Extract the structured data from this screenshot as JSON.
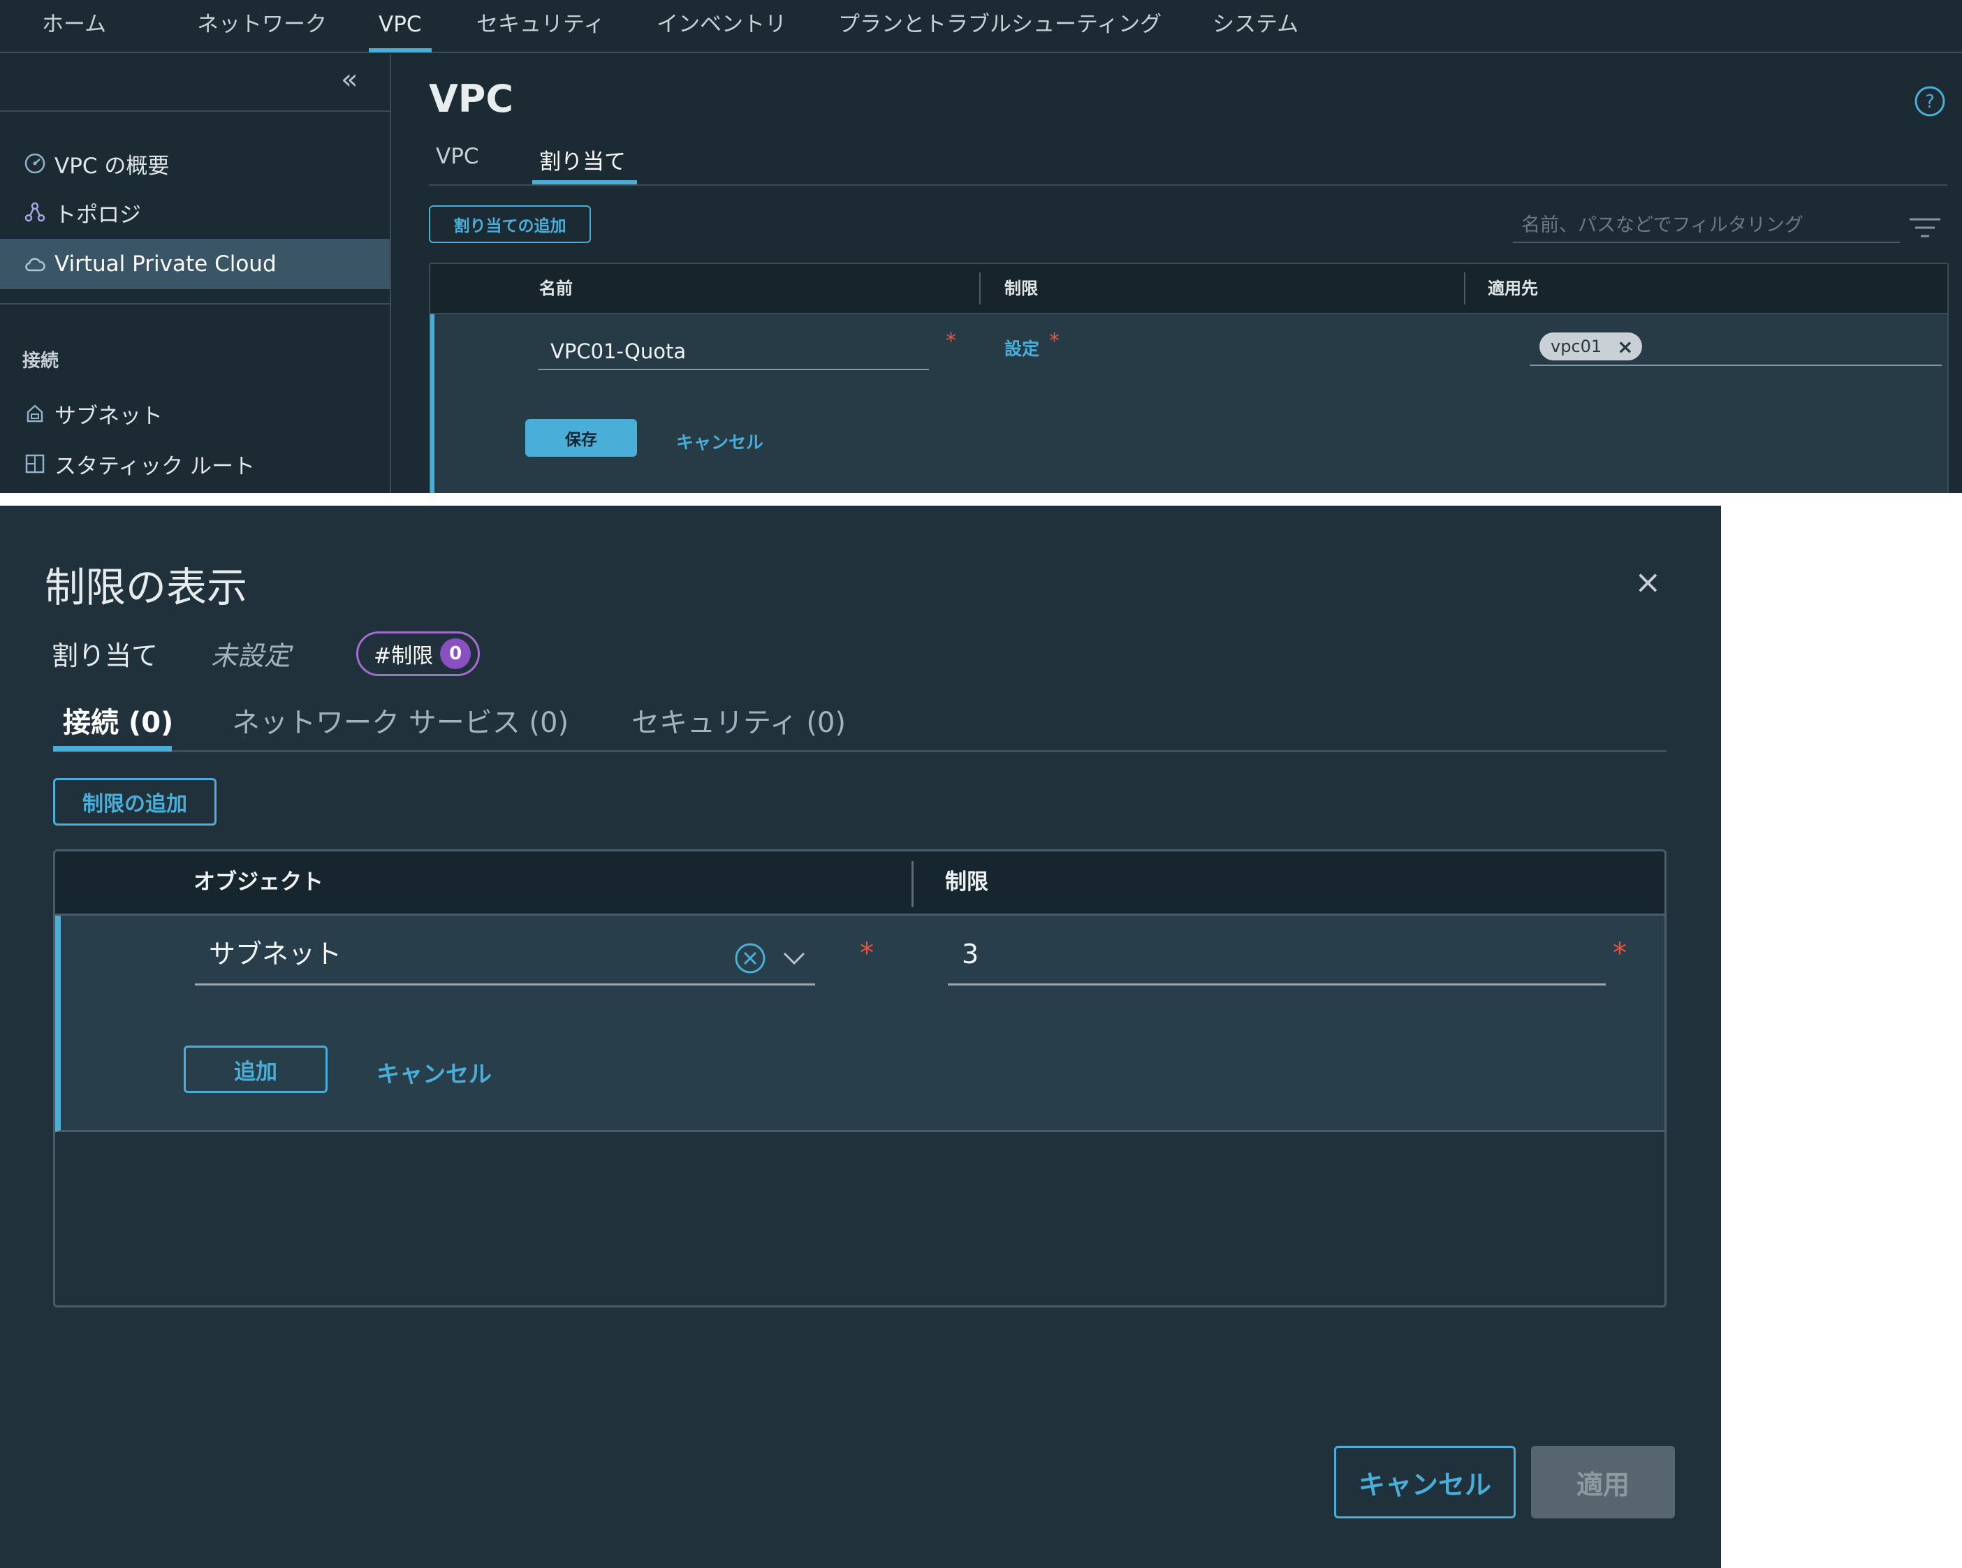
{
  "nav": {
    "items": [
      {
        "label": "ホーム"
      },
      {
        "label": "ネットワーク"
      },
      {
        "label": "VPC"
      },
      {
        "label": "セキュリティ"
      },
      {
        "label": "インベントリ"
      },
      {
        "label": "プランとトラブルシューティング"
      },
      {
        "label": "システム"
      }
    ],
    "active": "VPC"
  },
  "sidebar": {
    "collapse_glyph": "«",
    "items": [
      {
        "label": "VPC の概要",
        "icon": "gauge-icon"
      },
      {
        "label": "トポロジ",
        "icon": "topology-icon"
      },
      {
        "label": "Virtual Private Cloud",
        "icon": "cloud-icon"
      }
    ],
    "section_label": "接続",
    "section_items": [
      {
        "label": "サブネット",
        "icon": "subnet-icon"
      },
      {
        "label": "スタティック ルート",
        "icon": "static-route-icon"
      }
    ],
    "active": "Virtual Private Cloud"
  },
  "main": {
    "title": "VPC",
    "tabs": [
      {
        "label": "VPC"
      },
      {
        "label": "割り当て"
      }
    ],
    "active_tab": "割り当て",
    "add_button": "割り当ての追加",
    "filter_placeholder": "名前、パスなどでフィルタリング",
    "grid": {
      "columns": [
        "名前",
        "制限",
        "適用先"
      ],
      "row": {
        "name_value": "VPC01-Quota",
        "limit_link": "設定",
        "applied_chip": "vpc01",
        "save_label": "保存",
        "cancel_label": "キャンセル"
      }
    }
  },
  "modal": {
    "title": "制限の表示",
    "close_glyph": "×",
    "meta_label": "割り当て",
    "meta_value": "未設定",
    "badge_label": "#制限",
    "badge_count": "0",
    "tabs": [
      {
        "label": "接続 (0)"
      },
      {
        "label": "ネットワーク サービス (0)"
      },
      {
        "label": "セキュリティ (0)"
      }
    ],
    "active_tab": "接続 (0)",
    "add_limit_button": "制限の追加",
    "grid": {
      "columns": [
        "オブジェクト",
        "制限"
      ],
      "row": {
        "object_value": "サブネット",
        "limit_value": "3",
        "add_label": "追加",
        "cancel_label": "キャンセル"
      }
    },
    "footer": {
      "cancel_label": "キャンセル",
      "apply_label": "適用"
    }
  },
  "colors": {
    "accent": "#49afd9",
    "required": "#e8523e",
    "badge": "#a46bd1",
    "background": "#1b2a33",
    "modal_background": "#21313c"
  }
}
